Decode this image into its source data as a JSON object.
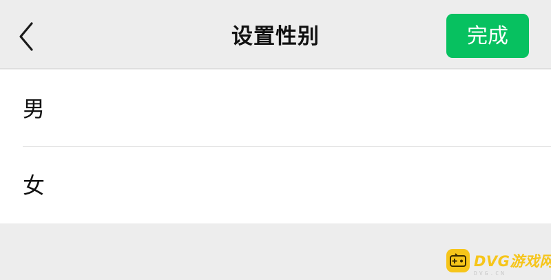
{
  "navbar": {
    "title": "设置性别",
    "back_icon": "chevron-left-icon",
    "done_label": "完成",
    "accent_color": "#07c160"
  },
  "options": [
    {
      "label": "男"
    },
    {
      "label": "女"
    }
  ],
  "watermark": {
    "logo_icon": "gamepad-icon",
    "text": "DVG游戏网",
    "subtext": "DVG.CN",
    "color": "#f6c51a"
  }
}
